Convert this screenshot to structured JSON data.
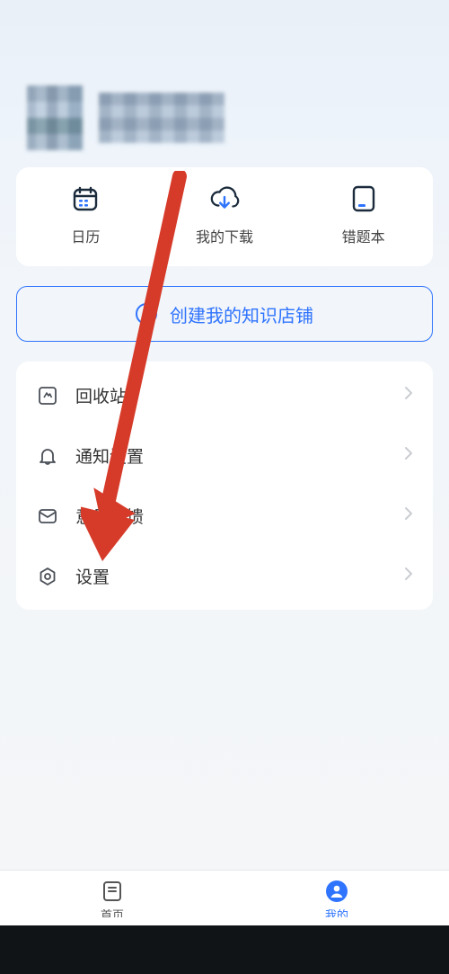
{
  "quick": {
    "calendar": "日历",
    "downloads": "我的下载",
    "mistakes": "错题本"
  },
  "store_button": "创建我的知识店铺",
  "menu": {
    "recycle": "回收站",
    "notification": "通知设置",
    "feedback": "意见反馈",
    "settings": "设置"
  },
  "nav": {
    "home": "首页",
    "mine": "我的"
  },
  "colors": {
    "accent": "#2f74ff",
    "annotation": "#d63b2a"
  }
}
